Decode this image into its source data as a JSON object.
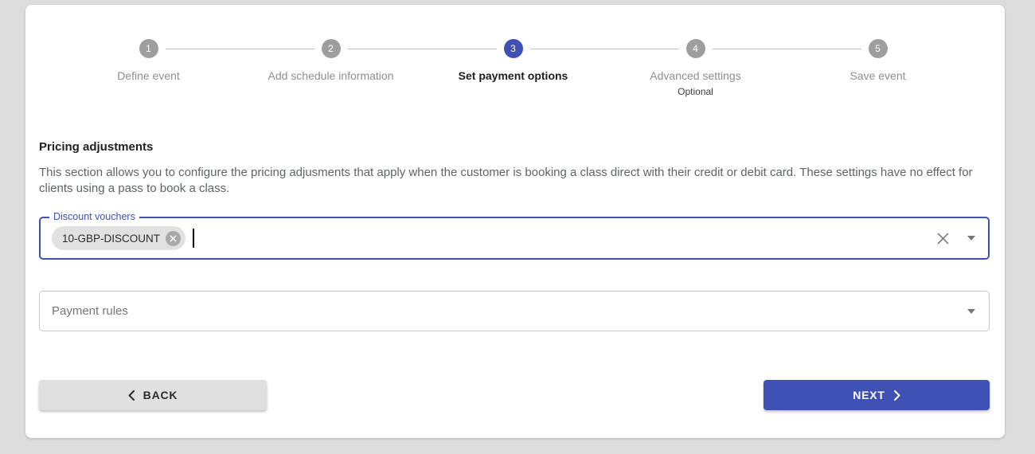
{
  "stepper": {
    "steps": [
      {
        "number": "1",
        "label": "Define event"
      },
      {
        "number": "2",
        "label": "Add schedule information"
      },
      {
        "number": "3",
        "label": "Set payment options"
      },
      {
        "number": "4",
        "label": "Advanced settings",
        "sublabel": "Optional"
      },
      {
        "number": "5",
        "label": "Save event"
      }
    ],
    "active_step": "3"
  },
  "section": {
    "title": "Pricing adjustments",
    "description": "This section allows you to configure the pricing adjusments that apply when the customer is booking a class direct with their credit or debit card. These settings have no effect for clients using a pass to book a class."
  },
  "discount_field": {
    "label": "Discount vouchers",
    "chips": [
      "10-GBP-DISCOUNT"
    ],
    "input_value": ""
  },
  "payment_field": {
    "placeholder": "Payment rules"
  },
  "buttons": {
    "back": "BACK",
    "next": "NEXT"
  },
  "icons": {
    "chip_remove": "✕",
    "clear": "✕"
  },
  "colors": {
    "accent": "#3f51b5",
    "inactive_step": "#9e9e9e",
    "page_background": "#dcdcdc",
    "card_background": "#ffffff",
    "chip_background": "#e1e1e1",
    "back_button_background": "#e0e0e0"
  }
}
